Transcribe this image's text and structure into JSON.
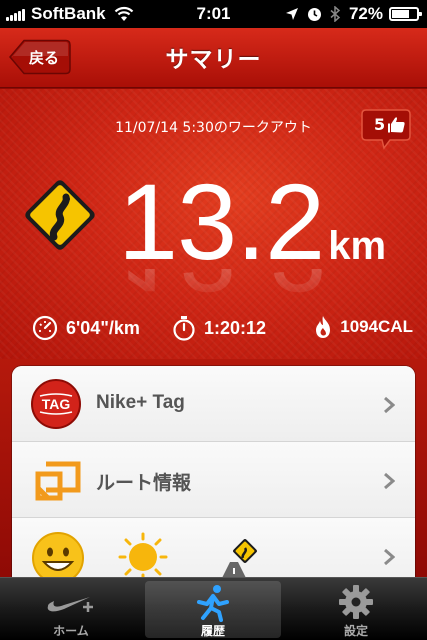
{
  "status_bar": {
    "carrier": "SoftBank",
    "time": "7:01",
    "battery_percent_label": "72%",
    "battery_level": 0.72
  },
  "nav": {
    "back_label": "戻る",
    "title": "サマリー"
  },
  "summary": {
    "workout_label": "11/07/14 5:30のワークアウト",
    "cheer_count": "5",
    "distance_value": "13.2",
    "distance_unit": "km",
    "pace": "6'04\"/km",
    "duration": "1:20:12",
    "calories": "1094CAL"
  },
  "list": {
    "items": [
      {
        "label": "Nike+ Tag",
        "icon": "tag-icon"
      },
      {
        "label": "ルート情報",
        "icon": "route-screen-icon"
      },
      {
        "label": "",
        "icon": "smiley-sun-route-icon"
      }
    ],
    "tag_badge": "TAG"
  },
  "tabs": [
    {
      "label": "ホーム",
      "icon": "nike-plus-icon",
      "active": false
    },
    {
      "label": "履歴",
      "icon": "runner-icon",
      "active": true
    },
    {
      "label": "設定",
      "icon": "gear-icon",
      "active": false
    }
  ],
  "colors": {
    "nav_red": "#c41d10",
    "summary_red": "#cf2615",
    "sign_yellow": "#f6c400",
    "tag_red": "#d2231a",
    "route_orange": "#f29a1c"
  }
}
